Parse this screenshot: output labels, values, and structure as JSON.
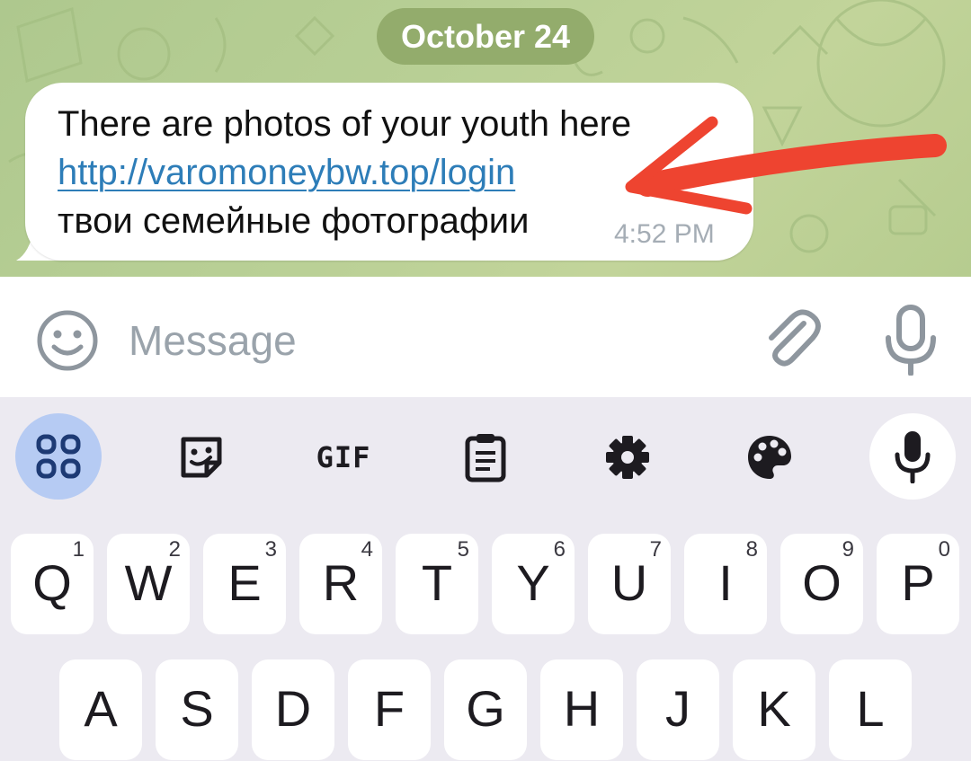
{
  "chat": {
    "date_label": "October 24",
    "message": {
      "line1": "There are photos of your youth here",
      "link": "http://varomoneybw.top/login",
      "line3": "твои семейные фотографии",
      "time": "4:52 PM"
    },
    "annotation": {
      "color": "#ee4430",
      "type": "red-arrow-pointing-at-link"
    }
  },
  "composer": {
    "placeholder": "Message",
    "icons": [
      "emoji-icon",
      "paperclip-icon",
      "microphone-icon"
    ]
  },
  "keyboard": {
    "toolbar": [
      {
        "name": "apps-grid-icon",
        "selected": true
      },
      {
        "name": "sticker-icon"
      },
      {
        "name": "gif",
        "label": "GIF"
      },
      {
        "name": "clipboard-icon"
      },
      {
        "name": "gear-icon"
      },
      {
        "name": "palette-icon"
      },
      {
        "name": "microphone-icon"
      }
    ],
    "row1": [
      {
        "key": "Q",
        "hint": "1"
      },
      {
        "key": "W",
        "hint": "2"
      },
      {
        "key": "E",
        "hint": "3"
      },
      {
        "key": "R",
        "hint": "4"
      },
      {
        "key": "T",
        "hint": "5"
      },
      {
        "key": "Y",
        "hint": "6"
      },
      {
        "key": "U",
        "hint": "7"
      },
      {
        "key": "I",
        "hint": "8"
      },
      {
        "key": "O",
        "hint": "9"
      },
      {
        "key": "P",
        "hint": "0"
      }
    ],
    "row2": [
      {
        "key": "A"
      },
      {
        "key": "S"
      },
      {
        "key": "D"
      },
      {
        "key": "F"
      },
      {
        "key": "G"
      },
      {
        "key": "H"
      },
      {
        "key": "J"
      },
      {
        "key": "K"
      },
      {
        "key": "L"
      }
    ]
  },
  "colors": {
    "chat_background": "#b6cc8f",
    "date_pill": "#93ac6c",
    "link": "#2d7db8",
    "keyboard_background": "#eceaf1",
    "selected_toolbar": "#b6cbf3"
  }
}
